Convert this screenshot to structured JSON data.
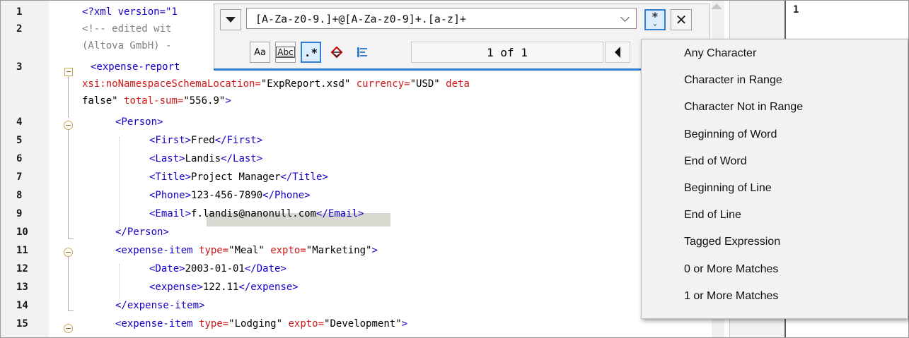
{
  "editor": {
    "line_numbers": [
      "1",
      "2",
      "",
      "3",
      "",
      "",
      "4",
      "5",
      "6",
      "7",
      "8",
      "9",
      "10",
      "11",
      "12",
      "13",
      "14",
      "15"
    ],
    "right_line_number": "1",
    "lines": [
      [
        {
          "t": "<?xml version=\"1",
          "c": "tag"
        }
      ],
      [
        {
          "t": "<!-- edited wit",
          "c": "cmt"
        }
      ],
      [
        {
          "t": "(Altova GmbH) -",
          "c": "cmt"
        }
      ],
      [
        {
          "t": "<expense-report",
          "c": "tag"
        }
      ],
      [
        {
          "t": "xsi:noNamespaceSchemaLocation=",
          "c": "attr"
        },
        {
          "t": "\"ExpReport.xsd\" ",
          "c": "val"
        },
        {
          "t": "currency=",
          "c": "attr"
        },
        {
          "t": "\"USD\" ",
          "c": "val"
        },
        {
          "t": "deta",
          "c": "attr"
        }
      ],
      [
        {
          "t": "false\" ",
          "c": "val"
        },
        {
          "t": "total-sum=",
          "c": "attr"
        },
        {
          "t": "\"556.9\"",
          "c": "val"
        },
        {
          "t": ">",
          "c": "tag"
        }
      ],
      [
        {
          "t": "<Person>",
          "c": "tag"
        }
      ],
      [
        {
          "t": "<First>",
          "c": "tag"
        },
        {
          "t": "Fred",
          "c": "txt"
        },
        {
          "t": "</First>",
          "c": "tag"
        }
      ],
      [
        {
          "t": "<Last>",
          "c": "tag"
        },
        {
          "t": "Landis",
          "c": "txt"
        },
        {
          "t": "</Last>",
          "c": "tag"
        }
      ],
      [
        {
          "t": "<Title>",
          "c": "tag"
        },
        {
          "t": "Project Manager",
          "c": "txt"
        },
        {
          "t": "</Title>",
          "c": "tag"
        }
      ],
      [
        {
          "t": "<Phone>",
          "c": "tag"
        },
        {
          "t": "123-456-7890",
          "c": "txt"
        },
        {
          "t": "</Phone>",
          "c": "tag"
        }
      ],
      [
        {
          "t": "<Email>",
          "c": "tag"
        },
        {
          "t": "f.landis@nanonull.com",
          "c": "txt"
        },
        {
          "t": "</Email>",
          "c": "tag"
        }
      ],
      [
        {
          "t": "</Person>",
          "c": "tag"
        }
      ],
      [
        {
          "t": "<expense-item ",
          "c": "tag"
        },
        {
          "t": "type=",
          "c": "attr"
        },
        {
          "t": "\"Meal\" ",
          "c": "val"
        },
        {
          "t": "expto=",
          "c": "attr"
        },
        {
          "t": "\"Marketing\"",
          "c": "val"
        },
        {
          "t": ">",
          "c": "tag"
        }
      ],
      [
        {
          "t": "<Date>",
          "c": "tag"
        },
        {
          "t": "2003-01-01",
          "c": "txt"
        },
        {
          "t": "</Date>",
          "c": "tag"
        }
      ],
      [
        {
          "t": "<expense>",
          "c": "tag"
        },
        {
          "t": "122.11",
          "c": "txt"
        },
        {
          "t": "</expense>",
          "c": "tag"
        }
      ],
      [
        {
          "t": "</expense-item>",
          "c": "tag"
        }
      ],
      [
        {
          "t": "<expense-item ",
          "c": "tag"
        },
        {
          "t": "type=",
          "c": "attr"
        },
        {
          "t": "\"Lodging\" ",
          "c": "val"
        },
        {
          "t": "expto=",
          "c": "attr"
        },
        {
          "t": "\"Development\"",
          "c": "val"
        },
        {
          "t": ">",
          "c": "tag"
        }
      ]
    ]
  },
  "find_bar": {
    "search_value": "[A-Za-z0-9.]+@[A-Za-z0-9]+.[a-z]+",
    "match_count": "1 of 1",
    "close_glyph": "✕",
    "regex_glyph": ".*",
    "case_label": "Aa",
    "word_label": "Abc",
    "regex_builder_glyph": "*"
  },
  "regex_menu": {
    "items": [
      "Any Character",
      "Character in Range",
      "Character Not in Range",
      "Beginning of Word",
      "End of Word",
      "Beginning of Line",
      "End of Line",
      "Tagged Expression",
      "0 or More Matches",
      "1 or More Matches"
    ]
  },
  "colors": {
    "tag": "#1200c8",
    "attribute": "#d01818",
    "comment": "#808080",
    "accent": "#2f7fd6"
  }
}
